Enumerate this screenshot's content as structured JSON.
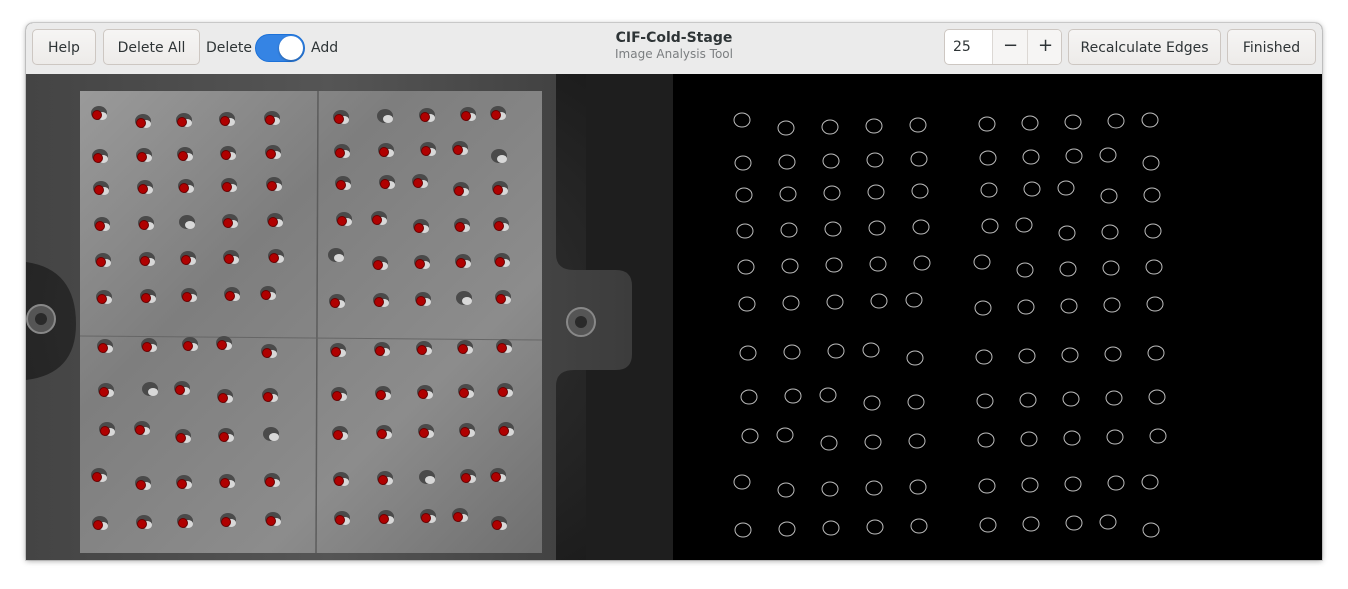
{
  "header": {
    "help_label": "Help",
    "delete_all_label": "Delete All",
    "mode_left_label": "Delete",
    "mode_right_label": "Add",
    "mode_toggle_state": "Add",
    "title": "CIF-Cold-Stage",
    "subtitle": "Image Analysis Tool",
    "spin_value": "25",
    "spin_minus": "−",
    "spin_plus": "+",
    "recalculate_label": "Recalculate Edges",
    "finished_label": "Finished"
  },
  "colors": {
    "accent": "#3584e4",
    "marker": "#b00000"
  },
  "panes": {
    "left": {
      "name": "sample-photo-with-markers"
    },
    "right": {
      "name": "edge-detection-result"
    }
  }
}
